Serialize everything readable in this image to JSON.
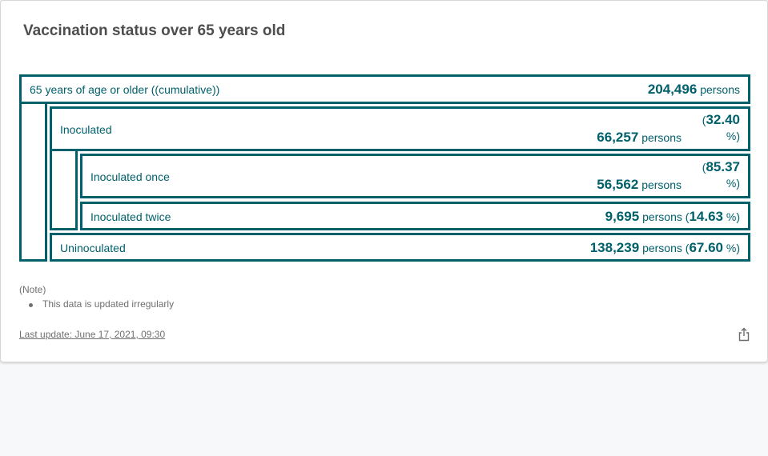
{
  "card": {
    "title": "Vaccination status over 65 years old"
  },
  "rows": {
    "total": {
      "label": "65 years of age or older ((cumulative))",
      "value": "204,496",
      "unit": "persons"
    },
    "inoculated": {
      "label": "Inoculated",
      "value": "66,257",
      "unit": "persons",
      "pct_open": "(",
      "pct": "32.40",
      "pct_close": "%)"
    },
    "once": {
      "label": "Inoculated once",
      "value": "56,562",
      "unit": "persons",
      "pct_open": "(",
      "pct": "85.37",
      "pct_close": "%)"
    },
    "twice": {
      "label": "Inoculated twice",
      "value": "9,695",
      "unit": "persons",
      "pct_open": "(",
      "pct": "14.63",
      "pct_close": "%)"
    },
    "uninoculated": {
      "label": "Uninoculated",
      "value": "138,239",
      "unit": "persons",
      "pct_open": "(",
      "pct": "67.60",
      "pct_close": "%)"
    }
  },
  "note": {
    "heading": "(Note)",
    "items": [
      "This data is updated irregularly"
    ]
  },
  "footer": {
    "last_update": "Last update: June 17, 2021, 09:30",
    "share_icon": "share-icon"
  },
  "colors": {
    "accent": "#00606b",
    "text_muted": "#707070"
  }
}
